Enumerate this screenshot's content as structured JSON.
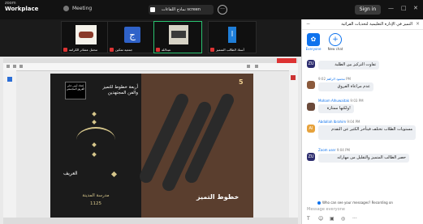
{
  "app": {
    "brand_top": "zoom",
    "brand_name": "Workplace",
    "meeting_label": "Meeting",
    "share_title": "نماذج اللقاءات screen",
    "more_label": "···",
    "signin_label": "Sign in",
    "win_min": "—",
    "win_max": "□",
    "win_close": "✕"
  },
  "thumbnails": [
    {
      "name": "محفل عشائر الكرامة"
    },
    {
      "name": "جمعية تمكين"
    },
    {
      "name": "عبدالله"
    },
    {
      "name": "أستاذ الطالب المتميز"
    }
  ],
  "slide": {
    "box_text": "إعداد أيمن جابر الفريق المجتمعي",
    "title_text": "أربعة خطوط للتميز والفن المجتهدين",
    "name_text": "العريف",
    "city_text": "مدرسة المدينة",
    "year_text": "1125",
    "page_num": "5",
    "calli_text": "خطوط التميز"
  },
  "chat_panel": {
    "title": "التميز في الإدارة التعليمية لتحديات القرائية",
    "close_icon": "×",
    "min_icon": "−",
    "tabs": [
      {
        "label": "Everyone",
        "icon": "✿"
      },
      {
        "label": "New chat",
        "icon": "+"
      }
    ],
    "messages": [
      {
        "avatar": "ZU",
        "avatar_color": "#2c2c6e",
        "sender": "",
        "time": "",
        "text": "تفاوت التركيز بين الطلبة"
      },
      {
        "avatar": "",
        "avatar_color": "#8b5a3c",
        "sender": "محمود الراهم",
        "time": "9:02 PM",
        "text": "عدم مراعاة الفروق"
      },
      {
        "avatar": "",
        "avatar_color": "#6b4a3a",
        "sender": "Moham Alhuwaitak",
        "time": "9:03 PM",
        "text": "ولكنها ممتازة!"
      },
      {
        "avatar": "AI",
        "avatar_color": "#e6a23c",
        "sender": "Abdallah Ibrahim",
        "time": "9:04 PM",
        "text": "مستويات الطلاب تختلف فيتأخر الكثير عن التقدم"
      },
      {
        "avatar": "ZU",
        "avatar_color": "#2c2c6e",
        "sender": "Zoom user",
        "time": "9:04 PM",
        "text": "حصر الطالب المتميز والتقليل من مهاراته"
      }
    ],
    "who_can_see": "Who can see your messages? Recording on",
    "message_placeholder": "Message everyone",
    "tool_icons": [
      "T",
      "☺",
      "▣",
      "◎",
      "···"
    ]
  }
}
